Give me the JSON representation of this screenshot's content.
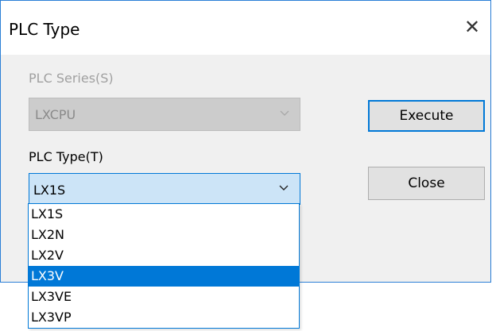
{
  "window": {
    "title": "PLC Type",
    "close_glyph": "✕"
  },
  "series": {
    "label": "PLC Series(S)",
    "value": "LXCPU",
    "enabled": false
  },
  "type": {
    "label": "PLC Type(T)",
    "value": "LX1S",
    "options": [
      "LX1S",
      "LX2N",
      "LX2V",
      "LX3V",
      "LX3VE",
      "LX3VP"
    ],
    "highlighted_option": "LX3V"
  },
  "buttons": {
    "execute": "Execute",
    "close": "Close"
  },
  "icons": {
    "close": "close-icon",
    "chevron": "chevron-down-icon"
  },
  "colors": {
    "accent": "#0078d7",
    "window_border": "#2b7fd6",
    "disabled_text": "#a0a0a0",
    "selection_bg": "#0078d7",
    "combo_focus_bg": "#cce4f7"
  }
}
